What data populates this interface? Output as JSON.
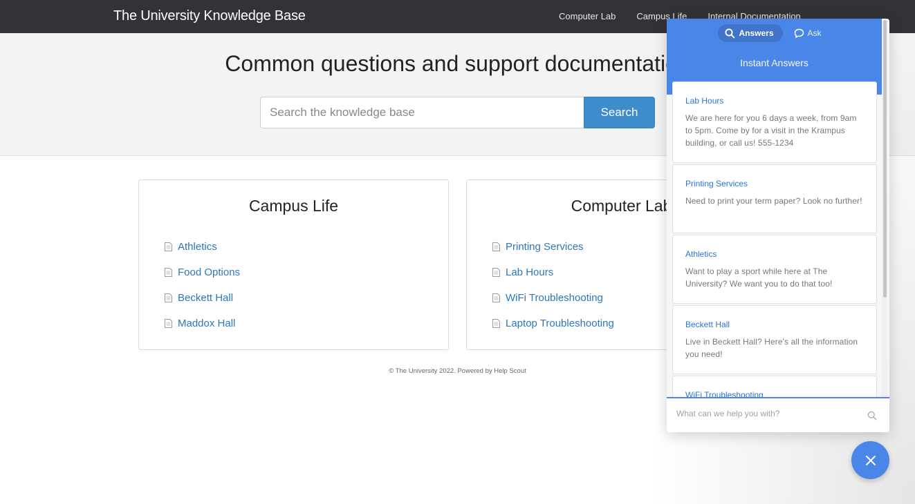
{
  "navbar": {
    "brand": "The University Knowledge Base",
    "links": [
      "Computer Lab",
      "Campus Life",
      "Internal Documentation"
    ]
  },
  "hero": {
    "title": "Common questions and support documentation",
    "search": {
      "placeholder": "Search the knowledge base",
      "value": "",
      "button_label": "Search"
    }
  },
  "categories": [
    {
      "title": "Campus Life",
      "items": [
        "Athletics",
        "Food Options",
        "Beckett Hall",
        "Maddox Hall"
      ]
    },
    {
      "title": "Computer Lab",
      "items": [
        "Printing Services",
        "Lab Hours",
        "WiFi Troubleshooting",
        "Laptop Troubleshooting"
      ]
    }
  ],
  "footer": {
    "text": "© The University 2022. Powered by Help Scout"
  },
  "beacon": {
    "tabs": [
      {
        "label": "Answers",
        "icon": "search-icon",
        "active": true
      },
      {
        "label": "Ask",
        "icon": "chat-bubble-icon",
        "active": false
      }
    ],
    "heading": "Instant Answers",
    "answers": [
      {
        "title": "Lab Hours",
        "text": "We are here for you 6 days a week, from 9am to 5pm. Come by for a visit in the Krampus building, or call us! 555-1234"
      },
      {
        "title": "Printing Services",
        "text": "Need to print your term paper? Look no further!"
      },
      {
        "title": "Athletics",
        "text": "Want to play a sport while here at The University? We want you to do that too!"
      },
      {
        "title": "Beckett Hall",
        "text": "Live in Beckett Hall? Here's all the information you need!"
      },
      {
        "title": "WiFi Troubleshooting",
        "text": ""
      }
    ],
    "input": {
      "placeholder": "What can we help you with?",
      "value": ""
    },
    "close_icon": "close-icon"
  },
  "colors": {
    "navbar": "#313336",
    "accent_button": "#3f8ccb",
    "link": "#2c76b8",
    "beacon_blue": "#4a86e8"
  }
}
